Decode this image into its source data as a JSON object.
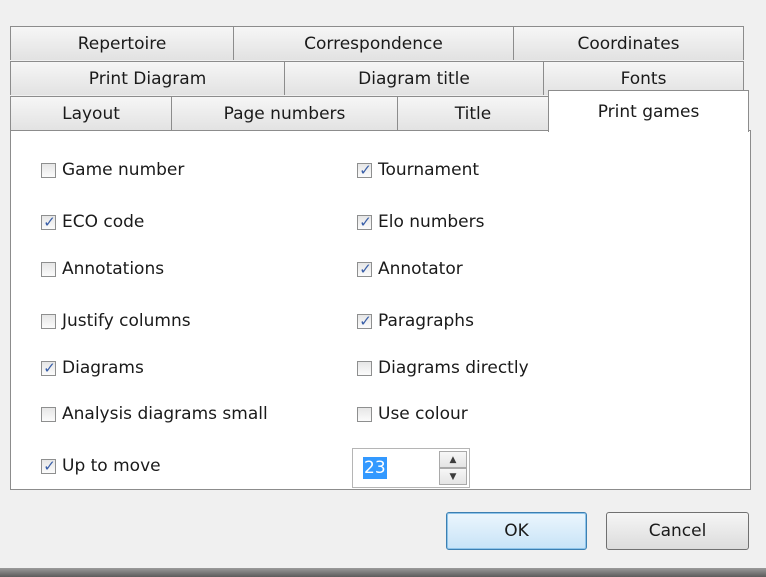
{
  "tabs": {
    "row1": [
      "Repertoire",
      "Correspondence",
      "Coordinates"
    ],
    "row2": [
      "Print Diagram",
      "Diagram title",
      "Fonts"
    ],
    "row3": [
      "Layout",
      "Page numbers",
      "Title",
      "Print games"
    ],
    "active": "Print games"
  },
  "options": {
    "left": [
      {
        "label": "Game number",
        "checked": false
      },
      {
        "label": "ECO code",
        "checked": true
      },
      {
        "label": "Annotations",
        "checked": false
      },
      {
        "label": "Justify columns",
        "checked": false
      },
      {
        "label": "Diagrams",
        "checked": true
      },
      {
        "label": "Analysis diagrams small",
        "checked": false
      },
      {
        "label": "Up to move",
        "checked": true
      }
    ],
    "right": [
      {
        "label": "Tournament",
        "checked": true
      },
      {
        "label": "Elo numbers",
        "checked": true
      },
      {
        "label": "Annotator",
        "checked": true
      },
      {
        "label": "Paragraphs",
        "checked": true
      },
      {
        "label": "Diagrams directly",
        "checked": false
      },
      {
        "label": "Use colour",
        "checked": false
      }
    ]
  },
  "move_spinner": {
    "value": "23"
  },
  "buttons": {
    "ok_label": "OK",
    "cancel_label": "Cancel"
  },
  "icons": {
    "check": "checkmark-icon",
    "up": "spin-up-icon",
    "down": "spin-down-icon"
  },
  "colors": {
    "check": "#3a5fa8",
    "selection": "#3399ff",
    "default_button": "#c7e3f7"
  }
}
